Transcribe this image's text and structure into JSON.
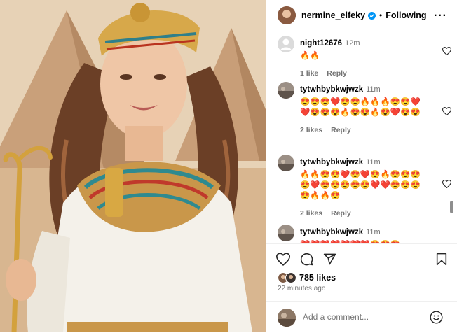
{
  "header": {
    "username": "nermine_elfeky",
    "separator": "•",
    "follow_state": "Following",
    "more_glyph": "···"
  },
  "comments": [
    {
      "username": "night12676",
      "time": "12m",
      "emojis": "🔥🔥",
      "likes": "1 like",
      "reply": "Reply"
    },
    {
      "username": "tytwhbybkwjwzk",
      "time": "11m",
      "emojis": "😍😍😍❤️😍😍🔥🔥🔥😍😍❤️❤️😍😍😍🔥😍😍🔥😍❤️😍😍",
      "likes": "2 likes",
      "reply": "Reply"
    },
    {
      "username": "tytwhbybkwjwzk",
      "time": "11m",
      "emojis": "🔥🔥😍😍❤️😍❤️😍🔥😍😍😍😍❤️😍😍😍😍😍❤️❤️😍😍😍😍🔥🔥😍",
      "likes": "2 likes",
      "reply": "Reply"
    },
    {
      "username": "tytwhbybkwjwzk",
      "time": "11m",
      "emojis": "❤️❤️❤️❤️❤️❤️❤️😍😍😍",
      "likes": "",
      "reply": ""
    }
  ],
  "actions": {
    "icons": [
      "heart-icon",
      "comment-icon",
      "share-icon",
      "bookmark-icon"
    ]
  },
  "likes": {
    "count_text": "785 likes"
  },
  "posted": "22 minutes ago",
  "add_comment": {
    "placeholder": "Add a comment..."
  },
  "colors": {
    "verified": "#0095f6",
    "secondary_text": "#737373",
    "divider": "#efefef"
  }
}
